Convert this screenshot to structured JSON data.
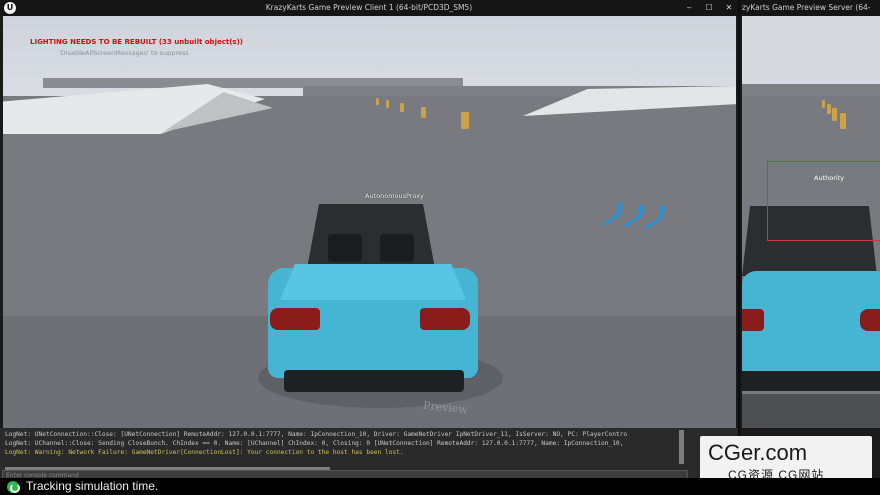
{
  "client_window": {
    "title": "KrazyKarts Game Preview Client 1 (64-bit/PCD3D_SM5)",
    "controls": [
      "‒",
      "☐",
      "✕"
    ]
  },
  "server_window": {
    "title": "zyKarts Game Preview Server (64-bit/PCD3D_SM5)"
  },
  "viewport": {
    "warning": "LIGHTING NEEDS TO BE REBUILT (33 unbuilt object(s))",
    "warning_hint": "'DisableAllScreenMessages' to suppress",
    "car_label": "AutonomousProxy",
    "watermark": "Preview",
    "warning_color": "#d21010"
  },
  "server_viewport": {
    "car_label": "Authority"
  },
  "console": {
    "lines": [
      "LogNet: UNetConnection::Close: [UNetConnection] RemoteAddr: 127.0.0.1:7777, Name: IpConnection_10, Driver: GameNetDriver IpNetDriver_11, IsServer: NO, PC: PlayerContro",
      "LogNet: UChannel::Close: Sending CloseBunch. ChIndex == 0. Name: [UChannel] ChIndex: 0, Closing: 0 [UNetConnection] RemoteAddr: 127.0.0.1:7777, Name: IpConnection_10,",
      "LogNet: Warning: Network Failure: GameNetDriver[ConnectionLost]: Your connection to the host has been lost."
    ],
    "input_placeholder": "Enter console command"
  },
  "overlay_logo": {
    "main": "CGer.com",
    "sub": "CG资源 CG网站"
  },
  "status_bar": {
    "text": "Tracking simulation time.",
    "icon": "sync-icon",
    "icon_color": "#2eb84a"
  }
}
